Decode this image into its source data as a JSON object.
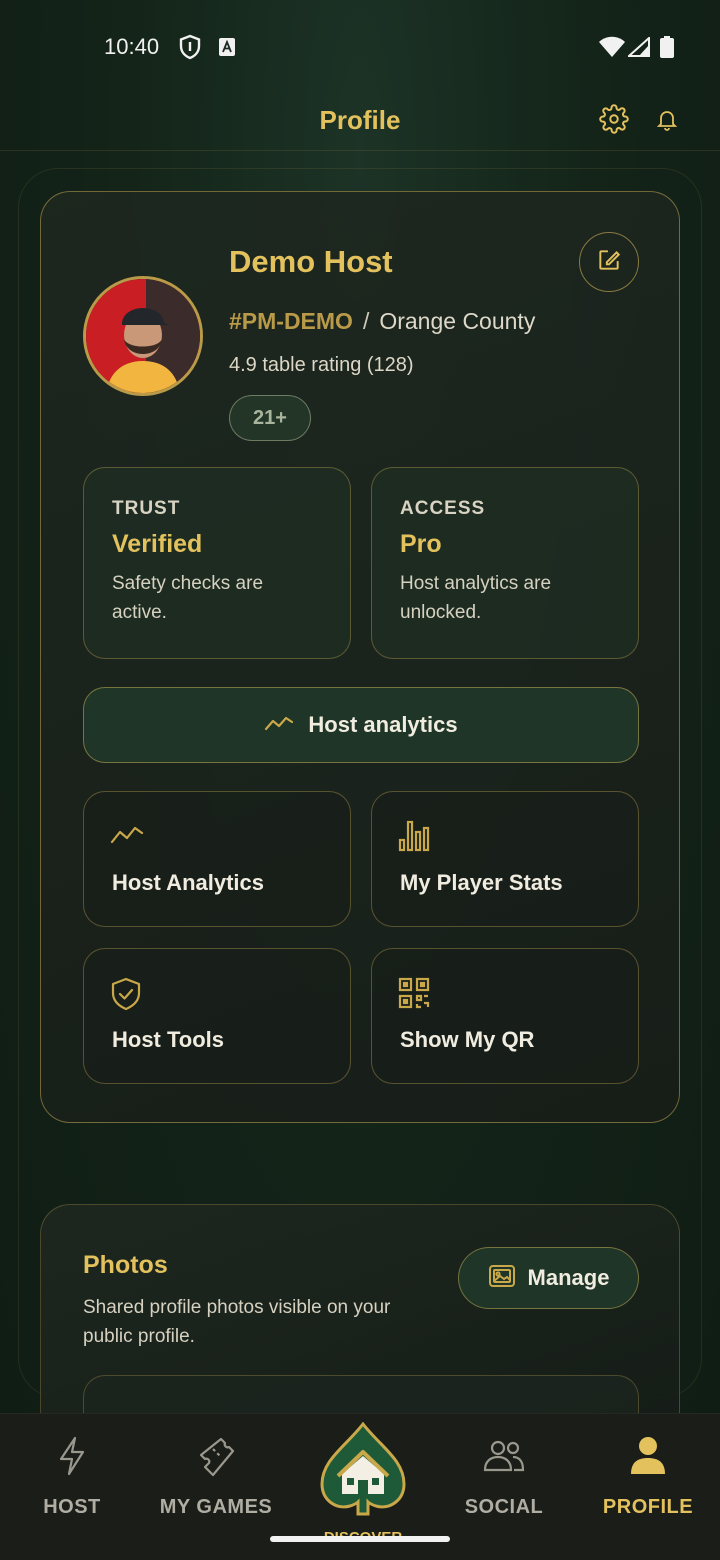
{
  "status_bar": {
    "time": "10:40"
  },
  "header": {
    "title": "Profile"
  },
  "profile": {
    "name": "Demo Host",
    "tag": "#PM-DEMO",
    "separator": "/",
    "location": "Orange County",
    "rating": "4.9 table rating (128)",
    "age_badge": "21+"
  },
  "info_boxes": [
    {
      "label": "TRUST",
      "value": "Verified",
      "desc": "Safety checks are active."
    },
    {
      "label": "ACCESS",
      "value": "Pro",
      "desc": "Host analytics are unlocked."
    }
  ],
  "analytics_button": "Host analytics",
  "tiles": [
    {
      "label": "Host Analytics",
      "icon": "trend-line-icon"
    },
    {
      "label": "My Player Stats",
      "icon": "bar-chart-icon"
    },
    {
      "label": "Host Tools",
      "icon": "shield-check-icon"
    },
    {
      "label": "Show My QR",
      "icon": "qr-code-icon"
    }
  ],
  "photos": {
    "title": "Photos",
    "desc": "Shared profile photos visible on your public profile.",
    "manage_label": "Manage"
  },
  "nav": {
    "host": "HOST",
    "my_games": "MY GAMES",
    "discover": "DISCOVER",
    "social": "SOCIAL",
    "profile": "PROFILE"
  },
  "colors": {
    "accent": "#e3c15d",
    "background": "#142419",
    "nav_bg": "#1a1d18"
  }
}
